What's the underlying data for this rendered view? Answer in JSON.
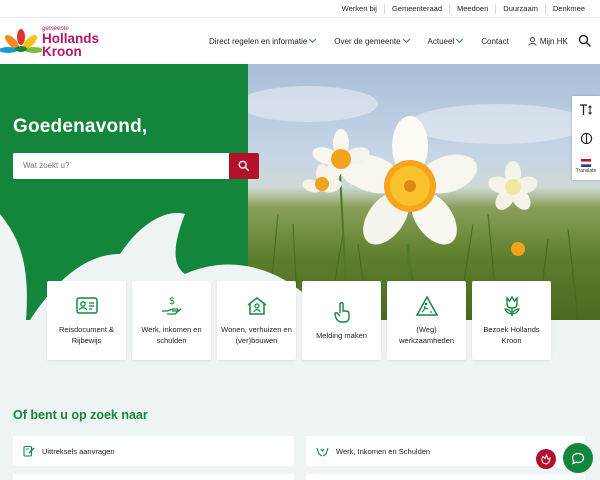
{
  "topbar": {
    "links": [
      "Werken bij",
      "Gemeenteraad",
      "Meedoen",
      "Duurzaam",
      "Denkmee"
    ]
  },
  "header": {
    "logo_small": "gemeente",
    "logo_line1": "Hollands",
    "logo_line2": "Kroon",
    "nav": {
      "item1": "Direct regelen en informatie",
      "item2": "Over de gemeente",
      "item3": "Actueel",
      "item4": "Contact",
      "user": "Mijn HK"
    }
  },
  "hero": {
    "greeting": "Goedenavond,",
    "search_placeholder": "Wat zoekt u?"
  },
  "sidetools": {
    "translate_label": "Translate"
  },
  "tiles": [
    {
      "label": "Reisdocument & Rijbewijs",
      "icon": "id-card-icon"
    },
    {
      "label": "Werk, inkomen en schulden",
      "icon": "money-hand-icon"
    },
    {
      "label": "Wonen, verhuizen en (ver)bouwen",
      "icon": "house-icon"
    },
    {
      "label": "Melding maken",
      "icon": "pointing-hand-icon"
    },
    {
      "label": "(Weg) werkzaamheden",
      "icon": "road-works-icon"
    },
    {
      "label": "Bezoek Hollands Kroon",
      "icon": "tulip-icon"
    }
  ],
  "section": {
    "title": "Of bent u op zoek naar",
    "links": [
      "Uittreksels aanvragen",
      "Werk, Inkomen en Schulden"
    ]
  },
  "colors": {
    "primary_green": "#13863c",
    "accent_red": "#b3102b",
    "brand_magenta": "#b0176b"
  }
}
